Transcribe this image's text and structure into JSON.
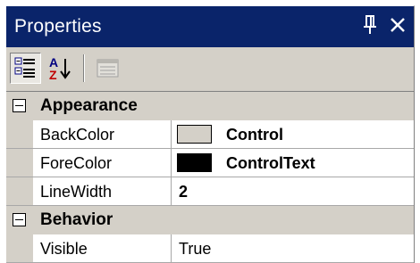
{
  "window": {
    "title": "Properties",
    "pin_glyph": "ᵖ",
    "close_glyph": "✕"
  },
  "toolbar": {
    "buttons": [
      {
        "name": "categorized-view",
        "icon": "categorized-icon",
        "pressed": true
      },
      {
        "name": "alphabetical-sort",
        "icon": "sort-az-icon",
        "pressed": false
      },
      {
        "name": "property-pages",
        "icon": "property-pages-icon",
        "pressed": false,
        "disabled": true
      }
    ]
  },
  "grid": {
    "categories": [
      {
        "label": "Appearance",
        "expanded": true,
        "properties": [
          {
            "name": "BackColor",
            "value": "Control",
            "swatch": "#d4d0c8",
            "bold": true
          },
          {
            "name": "ForeColor",
            "value": "ControlText",
            "swatch": "#000000",
            "bold": true
          },
          {
            "name": "LineWidth",
            "value": "2",
            "bold": true
          }
        ]
      },
      {
        "label": "Behavior",
        "expanded": true,
        "properties": [
          {
            "name": "Visible",
            "value": "True",
            "bold": false
          }
        ]
      }
    ]
  },
  "colors": {
    "titlebar": "#0a246a",
    "panel": "#d4d0c8",
    "grid_line": "#a8a8a8"
  }
}
